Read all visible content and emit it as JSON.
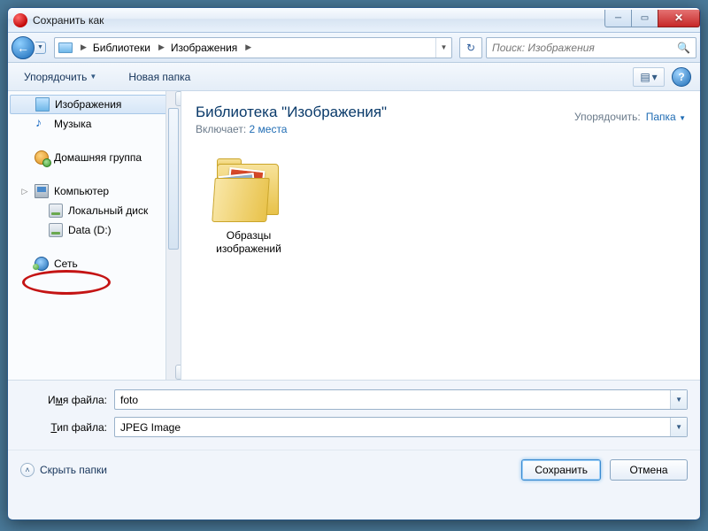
{
  "window": {
    "title": "Сохранить как"
  },
  "nav": {
    "breadcrumb": [
      "Библиотеки",
      "Изображения"
    ],
    "search_placeholder": "Поиск: Изображения"
  },
  "toolbar": {
    "organize": "Упорядочить",
    "new_folder": "Новая папка"
  },
  "sidebar": {
    "items": [
      {
        "label": "Изображения",
        "icon": "pictures",
        "selected": true
      },
      {
        "label": "Музыка",
        "icon": "music"
      },
      {
        "label": "Домашняя группа",
        "icon": "homegroup",
        "spaced": true
      },
      {
        "label": "Компьютер",
        "icon": "computer",
        "spaced": true,
        "expandable": true
      },
      {
        "label": "Локальный диск",
        "icon": "drive",
        "indent": true
      },
      {
        "label": "Data (D:)",
        "icon": "drive",
        "indent": true,
        "circled": true
      },
      {
        "label": "Сеть",
        "icon": "network",
        "spaced": true
      }
    ]
  },
  "content": {
    "library_title": "Библиотека \"Изображения\"",
    "includes_label": "Включает:",
    "includes_link": "2 места",
    "arrange_label": "Упорядочить:",
    "arrange_value": "Папка",
    "folders": [
      {
        "name": "Образцы изображений"
      }
    ]
  },
  "fields": {
    "filename_label_pre": "И",
    "filename_label_u": "м",
    "filename_label_post": "я файла:",
    "filename_value": "foto",
    "filetype_label_u": "Т",
    "filetype_label_post": "ип файла:",
    "filetype_value": "JPEG Image"
  },
  "footer": {
    "hide_folders": "Скрыть папки",
    "save": "Сохранить",
    "cancel": "Отмена"
  }
}
